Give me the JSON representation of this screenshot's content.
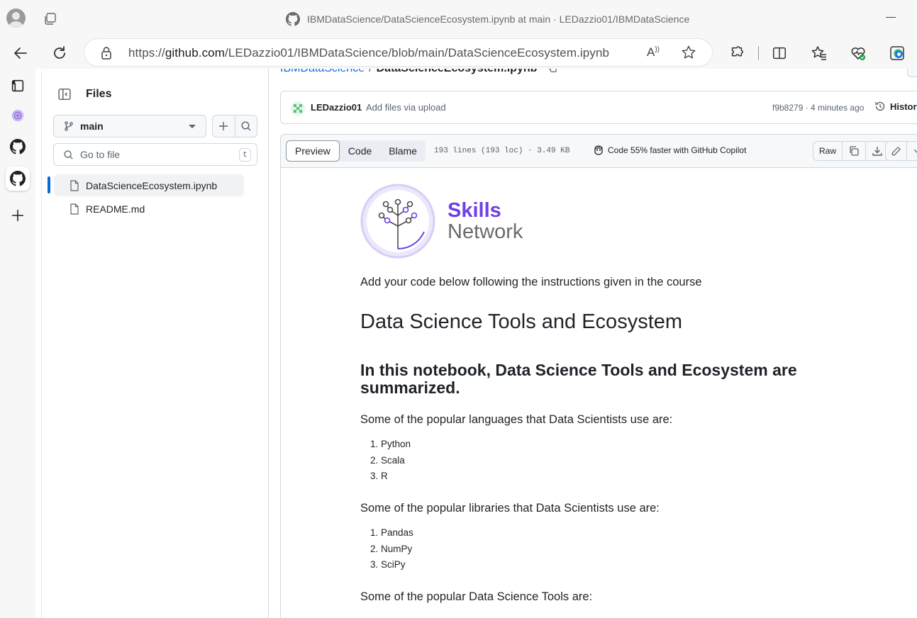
{
  "browser": {
    "window_title": "IBMDataScience/DataScienceEcosystem.ipynb at main · LEDazzio01/IBMDataScience",
    "url_prefix": "https://",
    "url_domain": "github.com",
    "url_path": "/LEDazzio01/IBMDataScience/blob/main/DataScienceEcosystem.ipynb",
    "read_aloud_label": "Aͅ",
    "icons": [
      "profile-icon",
      "tab-actions-icon",
      "github-icon",
      "back-icon",
      "refresh-icon",
      "lock-icon",
      "read-aloud-icon",
      "favorite-star-icon",
      "extensions-icon",
      "split-screen-icon",
      "favorites-icon",
      "browser-essentials-icon",
      "edge-icon",
      "minimize-icon"
    ]
  },
  "edge_sidebar": {
    "icons": [
      "workspaces-icon",
      "copilot-icon",
      "github-icon",
      "github-active-icon",
      "add-icon"
    ]
  },
  "file_tree": {
    "title": "Files",
    "branch": "main",
    "search_placeholder": "Go to file",
    "search_shortcut": "t",
    "items": [
      {
        "name": "DataScienceEcosystem.ipynb",
        "selected": true
      },
      {
        "name": "README.md",
        "selected": false
      }
    ]
  },
  "breadcrumb": {
    "repo": "IBMDataScience",
    "separator": "/",
    "file": "DataScienceEcosystem.ipynb"
  },
  "commit": {
    "user": "LEDazzio01",
    "message": "Add files via upload",
    "sha_time": "f9b8279 · 4 minutes ago",
    "history_label": "History"
  },
  "file_header": {
    "tabs": [
      "Preview",
      "Code",
      "Blame"
    ],
    "active_tab": "Preview",
    "meta": "193 lines (193 loc) · 3.49 KB",
    "copilot": "Code 55% faster with GitHub Copilot",
    "raw_label": "Raw"
  },
  "notebook": {
    "logo_line1": "Skills",
    "logo_line2": "Network",
    "intro": "Add your code below following the instructions given in the course",
    "h1": "Data Science Tools and Ecosystem",
    "h2": "In this notebook, Data Science Tools and Ecosystem are summarized.",
    "languages_heading": "Some of the popular languages that Data Scientists use are:",
    "languages": [
      "1. Python",
      "2. Scala",
      "3. R"
    ],
    "libraries_heading": "Some of the popular libraries that Data Scientists use are:",
    "libraries": [
      "1. Pandas",
      "2. NumPy",
      "3. SciPy"
    ],
    "tools_heading": "Some of the popular Data Science Tools are:"
  },
  "colors": {
    "link_blue": "#0969da",
    "skills_purple": "#6e3ee6",
    "border": "#d0d7de"
  }
}
